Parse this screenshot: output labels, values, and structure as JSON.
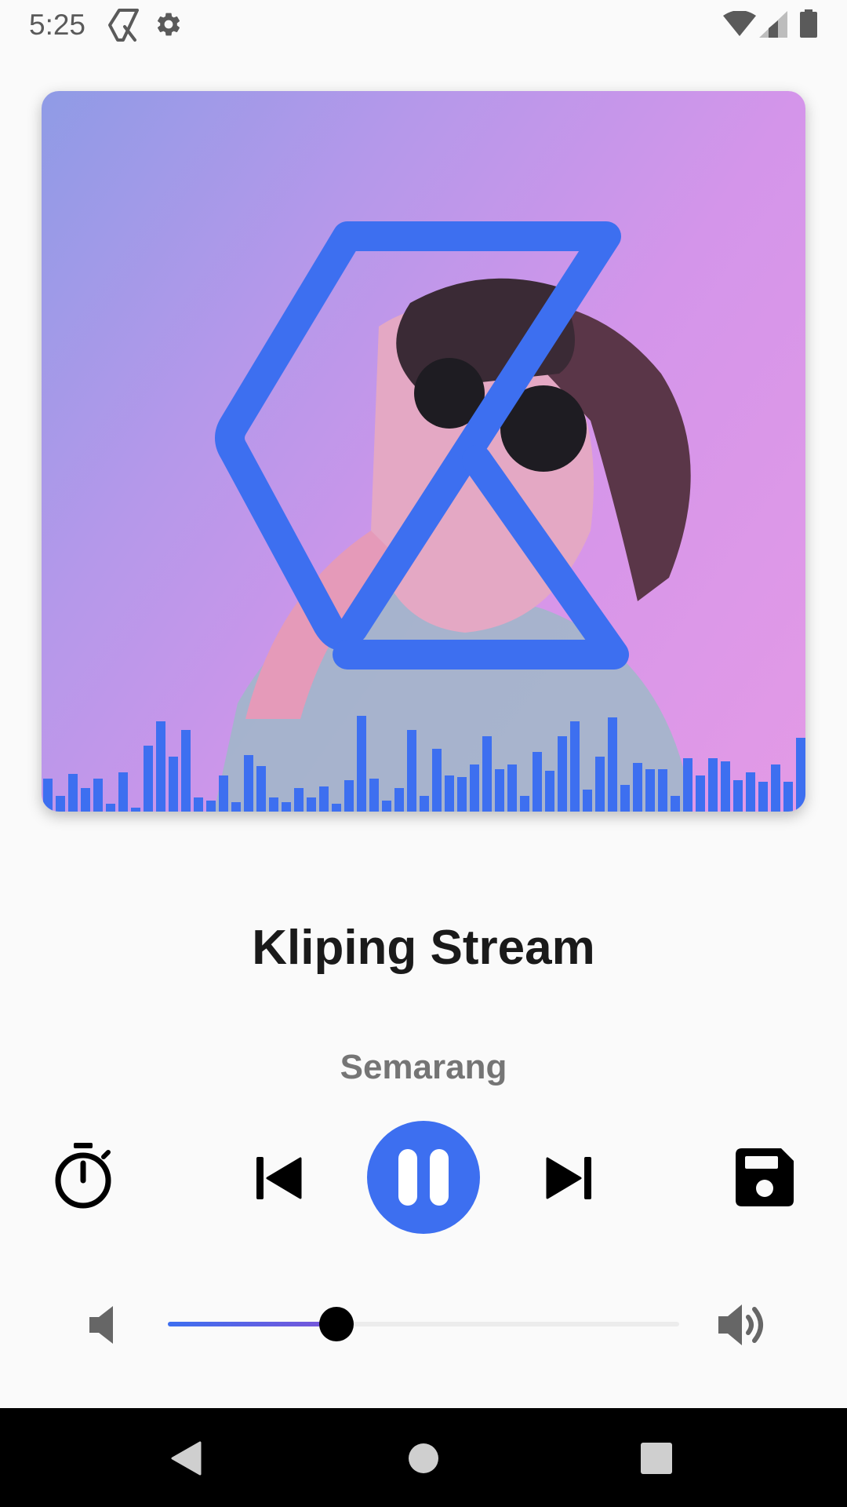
{
  "status_bar": {
    "time": "5:25",
    "icons": [
      "app-logo-icon",
      "settings-gear-icon",
      "wifi-icon",
      "cell-signal-icon",
      "battery-icon"
    ]
  },
  "album_art": {
    "image_description_icon": "album-art-photo",
    "overlay_logo": "kliping-logo",
    "accent_color": "#3d6ff0"
  },
  "track": {
    "title": "Kliping Stream",
    "location": "Semarang"
  },
  "controls": {
    "sleep_timer_icon": "timer-icon",
    "previous_icon": "skip-previous-icon",
    "play_pause_icon": "pause-icon",
    "next_icon": "skip-next-icon",
    "save_icon": "save-icon",
    "state": "playing"
  },
  "volume": {
    "level": 0.33,
    "low_icon": "volume-low-icon",
    "high_icon": "volume-high-icon"
  },
  "nav_bar": {
    "icons": [
      "back-icon",
      "home-icon",
      "recents-icon"
    ]
  },
  "colors": {
    "accent": "#3d6ff0",
    "text_primary": "#1a1a1a",
    "text_secondary": "#757575",
    "background": "#fafafa"
  }
}
